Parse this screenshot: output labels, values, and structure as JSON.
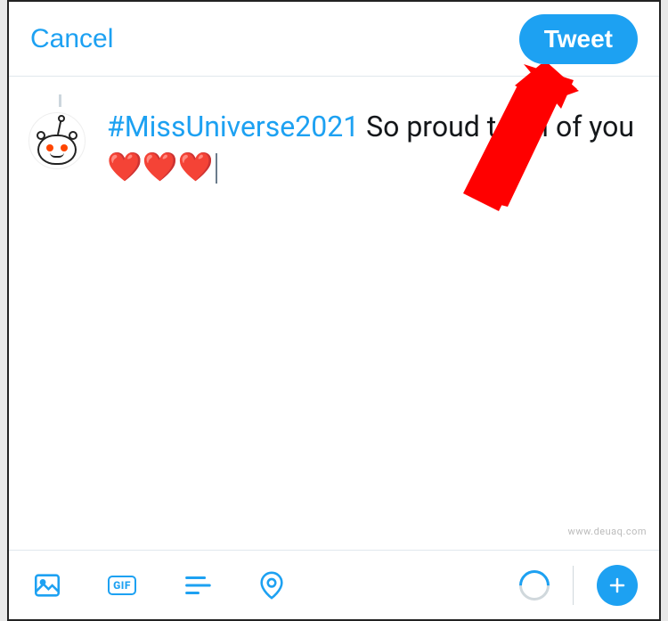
{
  "header": {
    "cancel_label": "Cancel",
    "tweet_label": "Tweet"
  },
  "compose": {
    "hashtag": "#MissUniverse2021",
    "text_before": "  So pro",
    "text_covered": "ud",
    "text_after": " to all of you ",
    "hearts": "❤️❤️❤️"
  },
  "toolbar": {
    "image_icon": "image-icon",
    "gif_label": "GIF",
    "poll_icon": "poll-icon",
    "location_icon": "location-icon",
    "add_icon": "plus-icon"
  },
  "watermark": "www.deuaq.com",
  "colors": {
    "brand": "#1da1f2",
    "arrow": "#ff0000"
  }
}
